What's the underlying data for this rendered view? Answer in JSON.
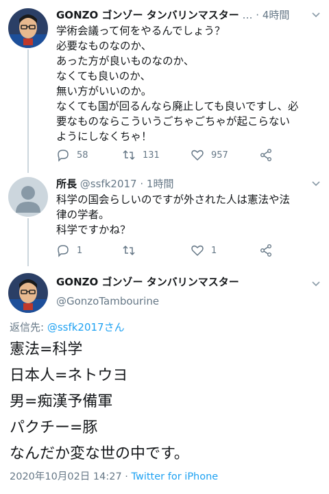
{
  "tweet1": {
    "name": "GONZO ゴンゾー タンバリンマスター",
    "ellipsis": "…",
    "time": "4時間",
    "lines": [
      "学術会議って何をやるんでしょう？",
      "必要なものなのか、",
      "あった方が良いものなのか、",
      "なくても良いのか、",
      "無い方がいいのか。",
      "なくても国が回るんなら廃止しても良いですし、必",
      "要なものならこういうごちゃごちゃが起こらない",
      "ようにしなくちゃ！"
    ],
    "reply_count": "58",
    "retweet_count": "131",
    "like_count": "957",
    "icons": [
      "reply-icon",
      "retweet-icon",
      "like-icon",
      "share-icon",
      "chevron-down-icon"
    ]
  },
  "tweet2": {
    "name": "所長",
    "handle": "@ssfk2017",
    "sep": "·",
    "time": "1時間",
    "lines": [
      "科学の国会らしいのですが外された人は憲法や法",
      "律の学者。",
      "科学ですかね？"
    ],
    "reply_count": "1",
    "retweet_count": "",
    "like_count": "1"
  },
  "main": {
    "name": "GONZO ゴンゾー タンバリンマスター",
    "handle": "@GonzoTambourine",
    "reply_prefix": "返信先: ",
    "reply_to": "@ssfk2017さん",
    "lines": [
      "憲法=科学",
      "日本人=ネトウヨ",
      "男=痴漢予備軍",
      "パクチー=豚",
      "なんだか変な世の中です。"
    ],
    "datetime": "2020年10月02日 14:27",
    "sep": " · ",
    "source": "Twitter for iPhone"
  },
  "colors": {
    "text": "#14171a",
    "muted": "#657786",
    "link": "#1da1f2",
    "line": "#ccd6dd"
  }
}
